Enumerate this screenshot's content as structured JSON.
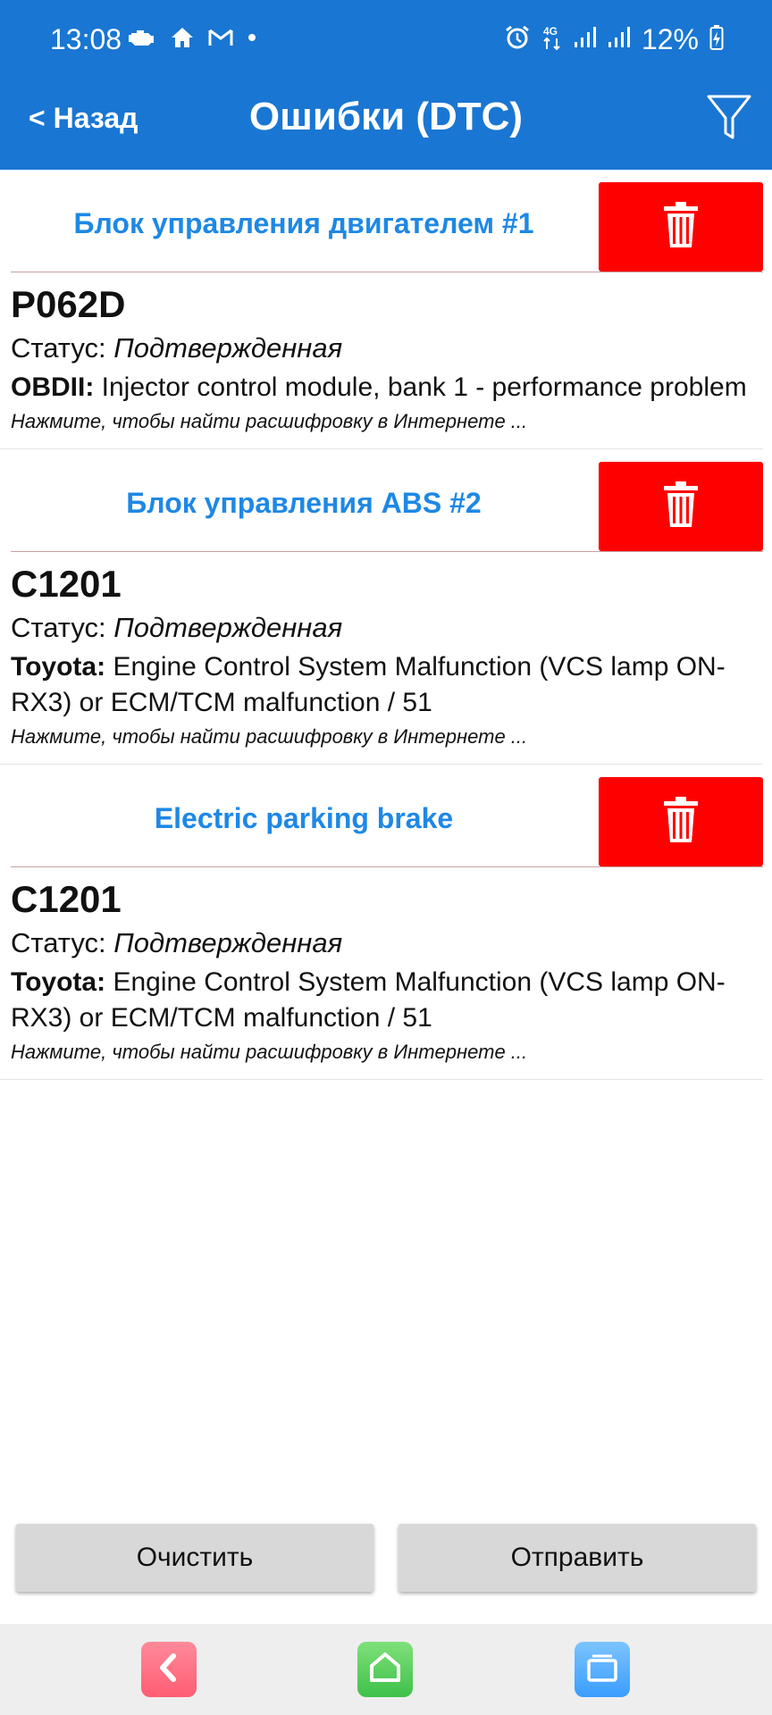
{
  "status_bar": {
    "time": "13:08",
    "left_icons": [
      "car-engine-icon",
      "home-icon",
      "mail-icon",
      "dot-icon"
    ],
    "right_icons": [
      "alarm-icon",
      "4g-icon",
      "signal-icon",
      "signal-icon",
      "battery-charging-icon"
    ],
    "network": "4G",
    "battery": "12%"
  },
  "app_bar": {
    "back_label": "< Назад",
    "title": "Ошибки (DTC)",
    "filter_icon": "filter-icon",
    "color": "#1976d2"
  },
  "modules": [
    {
      "name": "Блок управления двигателем #1",
      "dtcs": [
        {
          "code": "P062D",
          "status_label": "Статус: ",
          "status_value": "Подтвержденная",
          "desc_source": "OBDII:",
          "desc_text": " Injector control module, bank 1 - performance problem",
          "hint": "Нажмите, чтобы найти расшифровку в Интернете ..."
        }
      ]
    },
    {
      "name": "Блок управления ABS #2",
      "dtcs": [
        {
          "code": "C1201",
          "status_label": "Статус: ",
          "status_value": "Подтвержденная",
          "desc_source": "Toyota:",
          "desc_text": " Engine Control System Malfunction (VCS lamp ON-RX3) or ECM/TCM malfunction / 51",
          "hint": "Нажмите, чтобы найти расшифровку в Интернете ..."
        }
      ]
    },
    {
      "name": "Electric parking brake",
      "dtcs": [
        {
          "code": "C1201",
          "status_label": "Статус: ",
          "status_value": "Подтвержденная",
          "desc_source": "Toyota:",
          "desc_text": " Engine Control System Malfunction (VCS lamp ON-RX3) or ECM/TCM malfunction / 51",
          "hint": "Нажмите, чтобы найти расшифровку в Интернете ..."
        }
      ]
    }
  ],
  "buttons": {
    "clear_label": "Очистить",
    "send_label": "Отправить"
  },
  "nav_bar": {
    "icons": [
      "back-icon",
      "home-icon",
      "recent-apps-icon"
    ]
  },
  "colors": {
    "accent": "#1976d2",
    "module_text": "#1e88e5",
    "delete": "#ff0000"
  }
}
